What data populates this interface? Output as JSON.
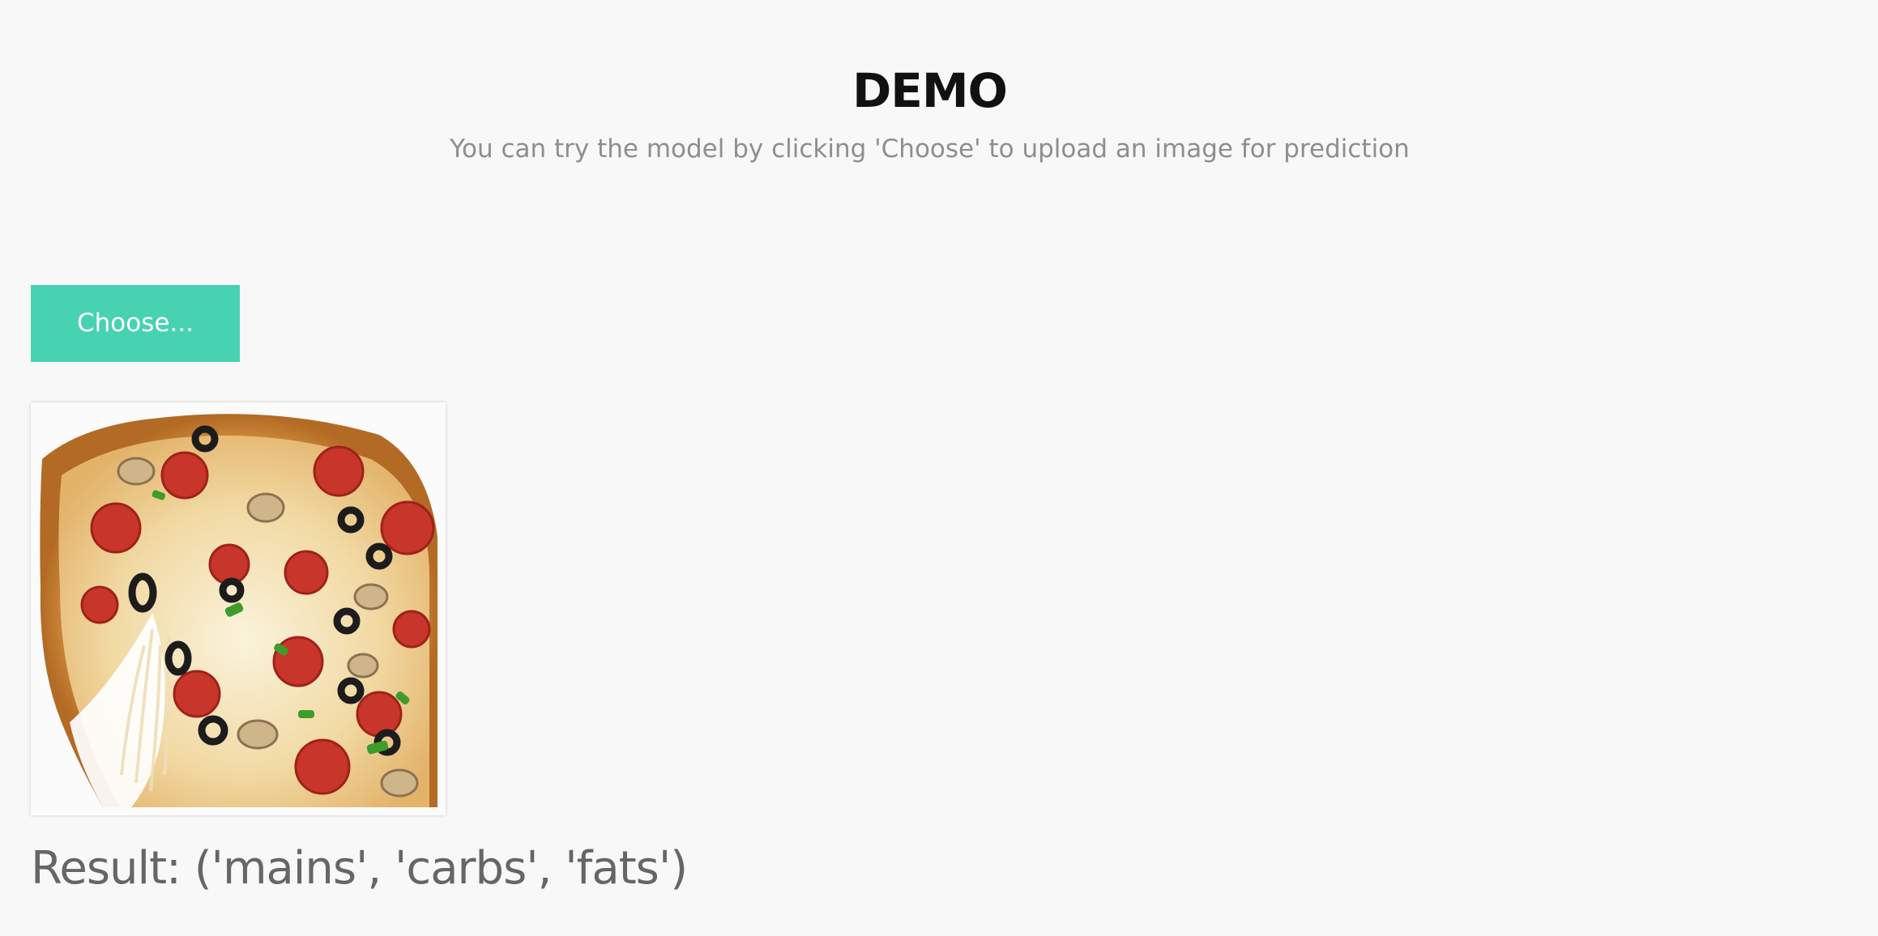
{
  "header": {
    "title": "DEMO",
    "subtitle": "You can try the model by clicking 'Choose' to upload an image for prediction"
  },
  "upload": {
    "button_label": "Choose..."
  },
  "preview": {
    "image_subject": "pizza-photo"
  },
  "result": {
    "text": "Result: ('mains', 'carbs', 'fats')"
  },
  "colors": {
    "background": "#f8f8f8",
    "accent": "#47d3b2",
    "title": "#111111",
    "subtitle": "#8e8e8e",
    "result": "#666666"
  }
}
